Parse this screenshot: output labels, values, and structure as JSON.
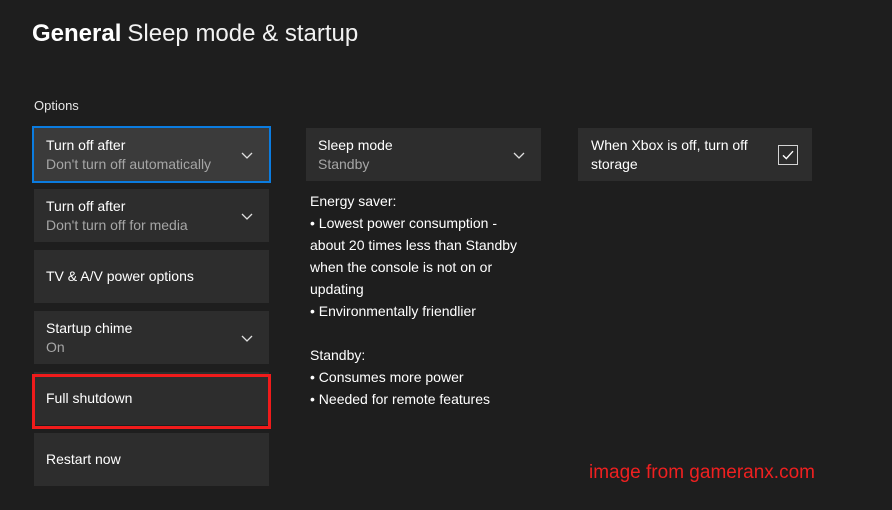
{
  "header": {
    "bold": "General",
    "light": "Sleep mode & startup"
  },
  "options": {
    "label": "Options",
    "items": [
      {
        "title": "Turn off after",
        "sub": "Don't turn off automatically",
        "chevron": "chevron-down-icon",
        "selected": true
      },
      {
        "title": "Turn off after",
        "sub": "Don't turn off for media",
        "chevron": "chevron-down-icon",
        "selected": false
      },
      {
        "title": "TV & A/V power options",
        "sub": "",
        "chevron": "",
        "selected": false
      },
      {
        "title": "Startup chime",
        "sub": "On",
        "chevron": "chevron-down-icon",
        "selected": false
      },
      {
        "title": "Full shutdown",
        "sub": "",
        "chevron": "",
        "selected": false
      },
      {
        "title": "Restart now",
        "sub": "",
        "chevron": "",
        "selected": false
      }
    ]
  },
  "sleep_mode": {
    "title": "Sleep mode",
    "value": "Standby",
    "chevron": "chevron-down-icon"
  },
  "description": {
    "energy_heading": "Energy saver:",
    "energy_lines": [
      "• Lowest power consumption -",
      "about 20 times less than Standby",
      "when the console is not on or",
      "updating",
      "• Environmentally friendlier"
    ],
    "standby_heading": "Standby:",
    "standby_lines": [
      "• Consumes more power",
      "• Needed for remote features"
    ]
  },
  "storage": {
    "label": "When Xbox is off, turn off storage",
    "checked": true,
    "checkbox_icon": "checkbox-checked-icon"
  },
  "watermark": {
    "text": "image from gameranx.com"
  },
  "colors": {
    "background": "#1e1e1e",
    "panel": "#2d2d2d",
    "panel_selected": "#3b3b3b",
    "focus_ring": "#0b7ce0",
    "annotation": "#f01b1b",
    "watermark": "#ef2020",
    "subtext": "#a6a6a6"
  }
}
